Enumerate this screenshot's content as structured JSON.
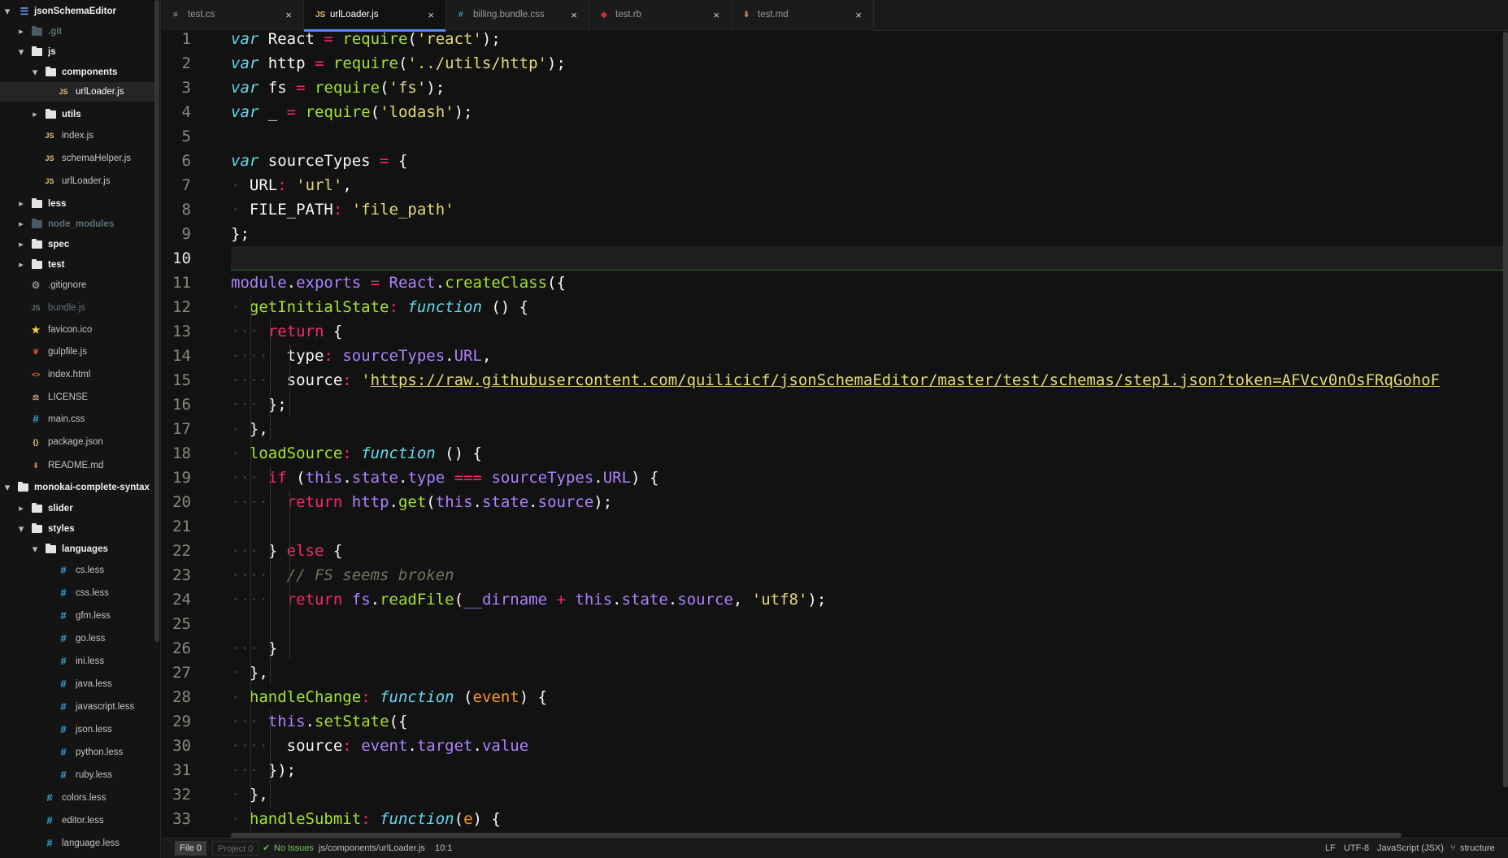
{
  "sidebar": {
    "items": [
      {
        "label": "jsonSchemaEditor",
        "kind": "root",
        "icon": "repo-icon",
        "expanded": true
      },
      {
        "label": ".git",
        "kind": "dir",
        "dim": true,
        "expanded": false
      },
      {
        "label": "js",
        "kind": "dir",
        "expanded": true
      },
      {
        "label": "components",
        "kind": "dir",
        "expanded": true
      },
      {
        "label": "urlLoader.js",
        "kind": "file",
        "icon": "js-icon",
        "selected": true
      },
      {
        "label": "utils",
        "kind": "dir",
        "expanded": false
      },
      {
        "label": "index.js",
        "kind": "file",
        "icon": "js-icon"
      },
      {
        "label": "schemaHelper.js",
        "kind": "file",
        "icon": "js-icon"
      },
      {
        "label": "urlLoader.js",
        "kind": "file",
        "icon": "js-icon"
      },
      {
        "label": "less",
        "kind": "dir",
        "expanded": false
      },
      {
        "label": "node_modules",
        "kind": "dir",
        "dim": true,
        "expanded": false
      },
      {
        "label": "spec",
        "kind": "dir",
        "expanded": false
      },
      {
        "label": "test",
        "kind": "dir",
        "expanded": false
      },
      {
        "label": ".gitignore",
        "kind": "file",
        "icon": "gear-icon"
      },
      {
        "label": "bundle.js",
        "kind": "file",
        "icon": "js-icon",
        "dim": true
      },
      {
        "label": "favicon.ico",
        "kind": "file",
        "icon": "star-icon"
      },
      {
        "label": "gulpfile.js",
        "kind": "file",
        "icon": "gulp-icon"
      },
      {
        "label": "index.html",
        "kind": "file",
        "icon": "html-icon"
      },
      {
        "label": "LICENSE",
        "kind": "file",
        "icon": "license-icon"
      },
      {
        "label": "main.css",
        "kind": "file",
        "icon": "hash-icon"
      },
      {
        "label": "package.json",
        "kind": "file",
        "icon": "braces-icon"
      },
      {
        "label": "README.md",
        "kind": "file",
        "icon": "markdown-icon"
      },
      {
        "label": "monokai-complete-syntax",
        "kind": "root",
        "icon": "folder-icon",
        "expanded": true
      },
      {
        "label": "slider",
        "kind": "dir",
        "expanded": false
      },
      {
        "label": "styles",
        "kind": "dir",
        "expanded": true
      },
      {
        "label": "languages",
        "kind": "dir",
        "expanded": true
      },
      {
        "label": "cs.less",
        "kind": "file",
        "icon": "hash-icon"
      },
      {
        "label": "css.less",
        "kind": "file",
        "icon": "hash-icon"
      },
      {
        "label": "gfm.less",
        "kind": "file",
        "icon": "hash-icon"
      },
      {
        "label": "go.less",
        "kind": "file",
        "icon": "hash-icon"
      },
      {
        "label": "ini.less",
        "kind": "file",
        "icon": "hash-icon"
      },
      {
        "label": "java.less",
        "kind": "file",
        "icon": "hash-icon"
      },
      {
        "label": "javascript.less",
        "kind": "file",
        "icon": "hash-icon"
      },
      {
        "label": "json.less",
        "kind": "file",
        "icon": "hash-icon"
      },
      {
        "label": "python.less",
        "kind": "file",
        "icon": "hash-icon"
      },
      {
        "label": "ruby.less",
        "kind": "file",
        "icon": "hash-icon"
      },
      {
        "label": "colors.less",
        "kind": "file",
        "icon": "hash-icon"
      },
      {
        "label": "editor.less",
        "kind": "file",
        "icon": "hash-icon"
      },
      {
        "label": "language.less",
        "kind": "file",
        "icon": "hash-icon"
      }
    ]
  },
  "tabs": [
    {
      "label": "test.cs",
      "icon": "text-icon",
      "active": false
    },
    {
      "label": "urlLoader.js",
      "icon": "js-icon",
      "active": true
    },
    {
      "label": "billing.bundle.css",
      "icon": "hash-icon",
      "active": false
    },
    {
      "label": "test.rb",
      "icon": "ruby-icon",
      "active": false
    },
    {
      "label": "test.md",
      "icon": "markdown-icon",
      "active": false
    }
  ],
  "tab_close_glyph": "×",
  "editor": {
    "current_line": 10,
    "line_numbers": [
      "1",
      "2",
      "3",
      "4",
      "5",
      "6",
      "7",
      "8",
      "9",
      "10",
      "11",
      "12",
      "13",
      "14",
      "15",
      "16",
      "17",
      "18",
      "19",
      "20",
      "21",
      "22",
      "23",
      "24",
      "25",
      "26",
      "27",
      "28",
      "29",
      "30",
      "31",
      "32",
      "33"
    ],
    "code_lines": [
      [
        [
          "st",
          "var"
        ],
        [
          "pn",
          " React "
        ],
        [
          "k",
          "="
        ],
        [
          "pn",
          " "
        ],
        [
          "f",
          "require"
        ],
        [
          "pn",
          "("
        ],
        [
          "s",
          "'react'"
        ],
        [
          "pn",
          ");"
        ]
      ],
      [
        [
          "st",
          "var"
        ],
        [
          "pn",
          " http "
        ],
        [
          "k",
          "="
        ],
        [
          "pn",
          " "
        ],
        [
          "f",
          "require"
        ],
        [
          "pn",
          "("
        ],
        [
          "s",
          "'../utils/http'"
        ],
        [
          "pn",
          ");"
        ]
      ],
      [
        [
          "st",
          "var"
        ],
        [
          "pn",
          " fs "
        ],
        [
          "k",
          "="
        ],
        [
          "pn",
          " "
        ],
        [
          "f",
          "require"
        ],
        [
          "pn",
          "("
        ],
        [
          "s",
          "'fs'"
        ],
        [
          "pn",
          ");"
        ]
      ],
      [
        [
          "st",
          "var"
        ],
        [
          "pn",
          " _ "
        ],
        [
          "k",
          "="
        ],
        [
          "pn",
          " "
        ],
        [
          "f",
          "require"
        ],
        [
          "pn",
          "("
        ],
        [
          "s",
          "'lodash'"
        ],
        [
          "pn",
          ");"
        ]
      ],
      [],
      [
        [
          "st",
          "var"
        ],
        [
          "pn",
          " sourceTypes "
        ],
        [
          "k",
          "="
        ],
        [
          "pn",
          " {"
        ]
      ],
      [
        [
          "inv",
          "·"
        ],
        [
          "pn",
          " URL"
        ],
        [
          "k",
          ":"
        ],
        [
          "pn",
          " "
        ],
        [
          "s",
          "'url'"
        ],
        [
          "pn",
          ","
        ]
      ],
      [
        [
          "inv",
          "·"
        ],
        [
          "pn",
          " FILE_PATH"
        ],
        [
          "k",
          ":"
        ],
        [
          "pn",
          " "
        ],
        [
          "s",
          "'file_path'"
        ]
      ],
      [
        [
          "pn",
          "};"
        ]
      ],
      [],
      [
        [
          "p",
          "module"
        ],
        [
          "pn",
          "."
        ],
        [
          "p",
          "exports"
        ],
        [
          "pn",
          " "
        ],
        [
          "k",
          "="
        ],
        [
          "pn",
          " "
        ],
        [
          "p",
          "React"
        ],
        [
          "pn",
          "."
        ],
        [
          "f",
          "createClass"
        ],
        [
          "pn",
          "({"
        ]
      ],
      [
        [
          "inv",
          "·"
        ],
        [
          "pn",
          " "
        ],
        [
          "f",
          "getInitialState"
        ],
        [
          "k",
          ":"
        ],
        [
          "pn",
          " "
        ],
        [
          "st",
          "function"
        ],
        [
          "pn",
          " () {"
        ]
      ],
      [
        [
          "inv",
          "···"
        ],
        [
          "pn",
          " "
        ],
        [
          "k",
          "return"
        ],
        [
          "pn",
          " {"
        ]
      ],
      [
        [
          "inv",
          "····"
        ],
        [
          "pn",
          "  type"
        ],
        [
          "k",
          ":"
        ],
        [
          "pn",
          " "
        ],
        [
          "p",
          "sourceTypes"
        ],
        [
          "pn",
          "."
        ],
        [
          "p",
          "URL"
        ],
        [
          "pn",
          ","
        ]
      ],
      [
        [
          "inv",
          "····"
        ],
        [
          "pn",
          "  source"
        ],
        [
          "k",
          ":"
        ],
        [
          "pn",
          " "
        ],
        [
          "s",
          "'"
        ],
        [
          "u",
          "https://raw.githubusercontent.com/quilicicf/jsonSchemaEditor/master/test/schemas/step1.json?token=AFVcv0nOsFRqGohoF"
        ]
      ],
      [
        [
          "inv",
          "···"
        ],
        [
          "pn",
          " };"
        ]
      ],
      [
        [
          "inv",
          "·"
        ],
        [
          "pn",
          " },"
        ]
      ],
      [
        [
          "inv",
          "·"
        ],
        [
          "pn",
          " "
        ],
        [
          "f",
          "loadSource"
        ],
        [
          "k",
          ":"
        ],
        [
          "pn",
          " "
        ],
        [
          "st",
          "function"
        ],
        [
          "pn",
          " () {"
        ]
      ],
      [
        [
          "inv",
          "···"
        ],
        [
          "pn",
          " "
        ],
        [
          "k",
          "if"
        ],
        [
          "pn",
          " ("
        ],
        [
          "p",
          "this"
        ],
        [
          "pn",
          "."
        ],
        [
          "p",
          "state"
        ],
        [
          "pn",
          "."
        ],
        [
          "p",
          "type"
        ],
        [
          "pn",
          " "
        ],
        [
          "k",
          "==="
        ],
        [
          "pn",
          " "
        ],
        [
          "p",
          "sourceTypes"
        ],
        [
          "pn",
          "."
        ],
        [
          "p",
          "URL"
        ],
        [
          "pn",
          ") {"
        ]
      ],
      [
        [
          "inv",
          "····"
        ],
        [
          "pn",
          "  "
        ],
        [
          "k",
          "return"
        ],
        [
          "pn",
          " "
        ],
        [
          "p",
          "http"
        ],
        [
          "pn",
          "."
        ],
        [
          "f",
          "get"
        ],
        [
          "pn",
          "("
        ],
        [
          "p",
          "this"
        ],
        [
          "pn",
          "."
        ],
        [
          "p",
          "state"
        ],
        [
          "pn",
          "."
        ],
        [
          "p",
          "source"
        ],
        [
          "pn",
          ");"
        ]
      ],
      [],
      [
        [
          "inv",
          "···"
        ],
        [
          "pn",
          " } "
        ],
        [
          "k",
          "else"
        ],
        [
          "pn",
          " {"
        ]
      ],
      [
        [
          "inv",
          "····"
        ],
        [
          "pn",
          "  "
        ],
        [
          "c",
          "// FS seems broken"
        ]
      ],
      [
        [
          "inv",
          "····"
        ],
        [
          "pn",
          "  "
        ],
        [
          "k",
          "return"
        ],
        [
          "pn",
          " "
        ],
        [
          "p",
          "fs"
        ],
        [
          "pn",
          "."
        ],
        [
          "f",
          "readFile"
        ],
        [
          "pn",
          "("
        ],
        [
          "p",
          "__dirname"
        ],
        [
          "pn",
          " "
        ],
        [
          "k",
          "+"
        ],
        [
          "pn",
          " "
        ],
        [
          "p",
          "this"
        ],
        [
          "pn",
          "."
        ],
        [
          "p",
          "state"
        ],
        [
          "pn",
          "."
        ],
        [
          "p",
          "source"
        ],
        [
          "pn",
          ", "
        ],
        [
          "s",
          "'utf8'"
        ],
        [
          "pn",
          ");"
        ]
      ],
      [],
      [
        [
          "inv",
          "···"
        ],
        [
          "pn",
          " }"
        ]
      ],
      [
        [
          "inv",
          "·"
        ],
        [
          "pn",
          " },"
        ]
      ],
      [
        [
          "inv",
          "·"
        ],
        [
          "pn",
          " "
        ],
        [
          "f",
          "handleChange"
        ],
        [
          "k",
          ":"
        ],
        [
          "pn",
          " "
        ],
        [
          "st",
          "function"
        ],
        [
          "pn",
          " ("
        ],
        [
          "v",
          "event"
        ],
        [
          "pn",
          ") {"
        ]
      ],
      [
        [
          "inv",
          "···"
        ],
        [
          "pn",
          " "
        ],
        [
          "p",
          "this"
        ],
        [
          "pn",
          "."
        ],
        [
          "f",
          "setState"
        ],
        [
          "pn",
          "({"
        ]
      ],
      [
        [
          "inv",
          "····"
        ],
        [
          "pn",
          "  source"
        ],
        [
          "k",
          ":"
        ],
        [
          "pn",
          " "
        ],
        [
          "p",
          "event"
        ],
        [
          "pn",
          "."
        ],
        [
          "p",
          "target"
        ],
        [
          "pn",
          "."
        ],
        [
          "p",
          "value"
        ]
      ],
      [
        [
          "inv",
          "···"
        ],
        [
          "pn",
          " });"
        ]
      ],
      [
        [
          "inv",
          "·"
        ],
        [
          "pn",
          " },"
        ]
      ],
      [
        [
          "inv",
          "·"
        ],
        [
          "pn",
          " "
        ],
        [
          "f",
          "handleSubmit"
        ],
        [
          "k",
          ":"
        ],
        [
          "pn",
          " "
        ],
        [
          "st",
          "function"
        ],
        [
          "pn",
          "("
        ],
        [
          "v",
          "e"
        ],
        [
          "pn",
          ") {"
        ]
      ]
    ]
  },
  "statusbar": {
    "file_label": "File 0",
    "project_label": "Project 0",
    "issues_label": "No Issues",
    "path": "js/components/urlLoader.js",
    "cursor_position": "10:1",
    "line_ending": "LF",
    "encoding": "UTF-8",
    "grammar": "JavaScript (JSX)",
    "structure_label": "structure"
  },
  "colors": {
    "accent": "#568af2",
    "keyword": "#f92672",
    "storage": "#66d9ef",
    "string": "#e6db74",
    "function": "#a6e22e",
    "constant": "#ae81ff",
    "parameter": "#fd971f",
    "comment": "#75715e"
  }
}
